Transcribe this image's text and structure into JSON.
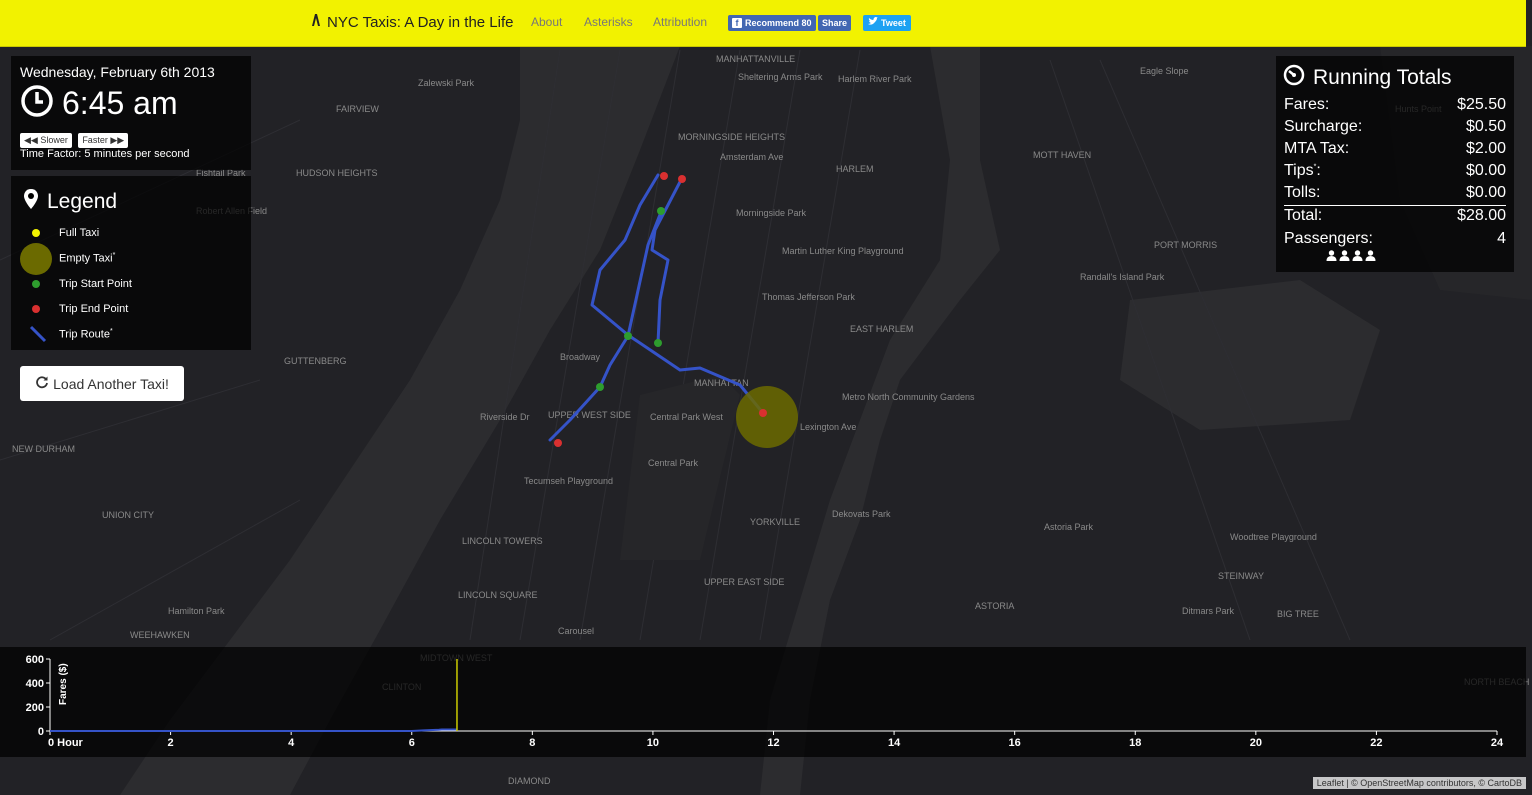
{
  "nav": {
    "brand": "NYC Taxis: A Day in the Life",
    "links": [
      "About",
      "Asterisks",
      "Attribution"
    ],
    "recommend_label": "Recommend 80",
    "share_label": "Share",
    "tweet_label": "Tweet",
    "bar_color": "#f2f200"
  },
  "clock": {
    "date": "Wednesday, February 6th 2013",
    "time": "6:45 am",
    "slower_label": "Slower",
    "faster_label": "Faster",
    "time_factor": "Time Factor: 5 minutes per second"
  },
  "legend": {
    "title": "Legend",
    "items": [
      {
        "label": "Full Taxi",
        "star": false,
        "color": "#f2f200"
      },
      {
        "label": "Empty Taxi",
        "star": true,
        "color": "#6b6a00"
      },
      {
        "label": "Trip Start Point",
        "star": false,
        "color": "#2e9d2e"
      },
      {
        "label": "Trip End Point",
        "star": false,
        "color": "#d93030"
      },
      {
        "label": "Trip Route",
        "star": true,
        "color": "#3553c8"
      }
    ]
  },
  "load_button": "Load Another Taxi!",
  "totals": {
    "title": "Running Totals",
    "rows": [
      {
        "label": "Fares:",
        "value": "$25.50"
      },
      {
        "label": "Surcharge:",
        "value": "$0.50"
      },
      {
        "label": "MTA Tax:",
        "value": "$2.00"
      },
      {
        "label": "Tips",
        "value": "$0.00"
      },
      {
        "label": "Tolls:",
        "value": "$0.00"
      }
    ],
    "total_label": "Total:",
    "total_value": "$28.00",
    "passengers_label": "Passengers:",
    "passengers_value": "4"
  },
  "map_labels": [
    "MANHATTANVILLE",
    "Sheltering Arms Park",
    "Harlem River Park",
    "Zalewski Park",
    "FAIRVIEW",
    "MORNINGSIDE HEIGHTS",
    "HARLEM",
    "MOTT HAVEN",
    "Eagle Slope",
    "Hunts Point",
    "HUDSON HEIGHTS",
    "Fishtail Park",
    "Robert Allen Field",
    "PORT MORRIS",
    "EAST HARLEM",
    "GUTTENBERG",
    "MANHATTAN",
    "UPPER WEST SIDE",
    "Metro North Community Gardens",
    "NEW DURHAM",
    "Central Park",
    "UNION CITY",
    "YORKVILLE",
    "Dekovats Park",
    "Astoria Park",
    "Woodtree Playground",
    "STEINWAY",
    "LINCOLN TOWERS",
    "LINCOLN SQUARE",
    "UPPER EAST SIDE",
    "ASTORIA",
    "Ditmars Park",
    "BIG TREE",
    "WEEHAWKEN",
    "Hamilton Park",
    "CLINTON",
    "MIDTOWN WEST",
    "DIAMOND",
    "NORTH BEACH",
    "Morningside Park",
    "Martin Luther King Playground",
    "Thomas Jefferson Park",
    "Tecumseh Playground",
    "Carousel",
    "Randall's Island Park",
    "Central Park West",
    "Broadway",
    "Amsterdam Ave",
    "Riverside Dr",
    "Lexington Ave"
  ],
  "chart_data": {
    "type": "line",
    "ylabel": "Fares ($)",
    "xlabel": "",
    "yticks": [
      0,
      200,
      400,
      600
    ],
    "ylim": [
      0,
      600
    ],
    "xticks": [
      0,
      2,
      4,
      6,
      8,
      10,
      12,
      14,
      16,
      18,
      20,
      22,
      24
    ],
    "xtick_labels": [
      "0 Hour",
      "2",
      "4",
      "6",
      "8",
      "10",
      "12",
      14,
      "16",
      "18",
      "20",
      "22",
      "24"
    ],
    "xlim": [
      0,
      24
    ],
    "series": [
      {
        "x": [
          0,
          6.0,
          6.2,
          6.45,
          6.5,
          6.75
        ],
        "y": [
          0,
          0,
          5,
          10,
          12,
          12
        ]
      }
    ],
    "current_time_marker": 6.75,
    "marker_color": "#cccc00"
  },
  "attribution": "Leaflet | © OpenStreetMap contributors, © CartoDB"
}
